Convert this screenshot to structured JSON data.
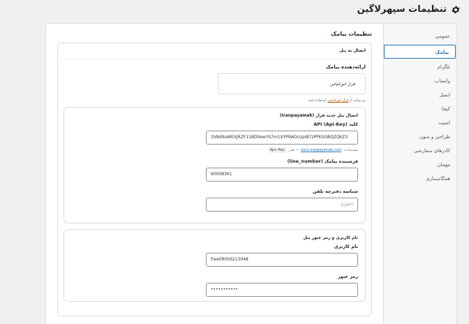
{
  "header": {
    "title": "تنظیمات سپهرلاگین",
    "icon": "gear-icon"
  },
  "nav": {
    "items": [
      {
        "label": "عمومی",
        "active": false
      },
      {
        "label": "پیامک",
        "active": true
      },
      {
        "label": "تلگرام",
        "active": false
      },
      {
        "label": "واتساپ",
        "active": false
      },
      {
        "label": "ایمیل",
        "active": false
      },
      {
        "label": "کپچا",
        "active": false
      },
      {
        "label": "امنیت",
        "active": false
      },
      {
        "label": "طراحی و متون",
        "active": false
      },
      {
        "label": "کادرهای سفارشی",
        "active": false
      },
      {
        "label": "مهمان",
        "active": false
      },
      {
        "label": "همگام‌سازی",
        "active": false
      }
    ]
  },
  "main": {
    "section_title": "تنظیمات پیامک",
    "panel_title": "اتصال به پنل",
    "provider_label": "ارائه‌دهنده پیامک",
    "provider_value": "فراز اس‌ام‌اس",
    "provider_help_prefix": "می‌توانید از",
    "provider_help_link": "فراز اس‌ام‌اس",
    "provider_help_suffix": "استفاده کنید.",
    "new_panel": {
      "title": "اتصال پنل جدید فراز (Iranpayamak)",
      "api_key_label": "کلید API (Api-Key)",
      "api_key_value": "3V8d9aWEXjRZF11BDllewYS7m1XYP9AOcUpI87zPPKSGBQZQkZ3",
      "docs_prefix": "مستندات:",
      "docs_link": "docs.iranpayamak.com",
      "docs_middle": "— هدر",
      "docs_header_code": "Api-Key",
      "sender_label": "فرستنده پیامک (line_number)",
      "sender_value": "90008361",
      "template_label": "شناسه دفترچه تلفن",
      "template_placeholder": "اختیاری"
    },
    "old_panel": {
      "title": "نام کاربری و رمز عبور پنل",
      "username_label": "نام کاربری",
      "username_value": "free09056213048",
      "password_label": "رمز عبور",
      "password_value": "•••••••••••"
    }
  }
}
